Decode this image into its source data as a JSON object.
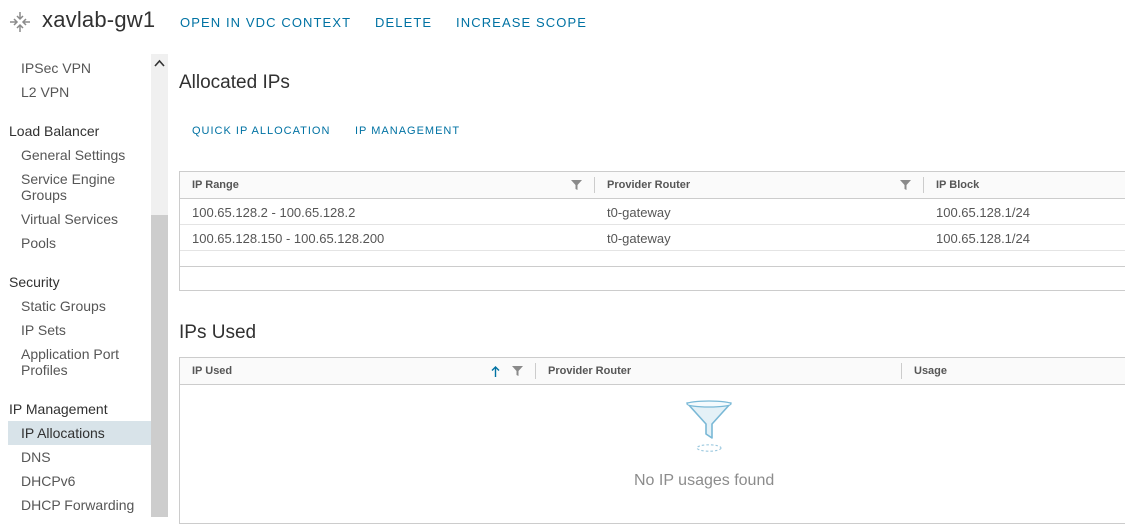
{
  "header": {
    "title": "xavlab-gw1",
    "actions": [
      "OPEN IN VDC CONTEXT",
      "DELETE",
      "INCREASE SCOPE"
    ]
  },
  "sidebar": {
    "items": [
      {
        "type": "item",
        "label": "IPSec VPN"
      },
      {
        "type": "item",
        "label": "L2 VPN"
      },
      {
        "type": "group",
        "label": "Load Balancer"
      },
      {
        "type": "item",
        "label": "General Settings"
      },
      {
        "type": "item",
        "label": "Service Engine Groups"
      },
      {
        "type": "item",
        "label": "Virtual Services"
      },
      {
        "type": "item",
        "label": "Pools"
      },
      {
        "type": "group",
        "label": "Security"
      },
      {
        "type": "item",
        "label": "Static Groups"
      },
      {
        "type": "item",
        "label": "IP Sets"
      },
      {
        "type": "item",
        "label": "Application Port Profiles"
      },
      {
        "type": "group",
        "label": "IP Management"
      },
      {
        "type": "item",
        "label": "IP Allocations",
        "active": true
      },
      {
        "type": "item",
        "label": "DNS"
      },
      {
        "type": "item",
        "label": "DHCPv6"
      },
      {
        "type": "item",
        "label": "DHCP Forwarding"
      }
    ]
  },
  "allocated": {
    "title": "Allocated IPs",
    "actions": [
      "QUICK IP ALLOCATION",
      "IP MANAGEMENT"
    ],
    "columns": [
      "IP Range",
      "Provider Router",
      "IP Block"
    ],
    "rows": [
      [
        "100.65.128.2 - 100.65.128.2",
        "t0-gateway",
        "100.65.128.1/24"
      ],
      [
        "100.65.128.150 - 100.65.128.200",
        "t0-gateway",
        "100.65.128.1/24"
      ]
    ]
  },
  "used": {
    "title": "IPs Used",
    "columns": [
      "IP Used",
      "Provider Router",
      "Usage"
    ],
    "empty_text": "No IP usages found"
  },
  "colors": {
    "link": "#0072a3",
    "active_bg": "#d8e3e9"
  },
  "icons": {
    "gateway": "gateway-arrows-icon",
    "filter": "filter-icon",
    "sort": "sort-ascending-icon",
    "scroll_up": "chevron-up-icon",
    "empty": "empty-funnel-icon"
  }
}
